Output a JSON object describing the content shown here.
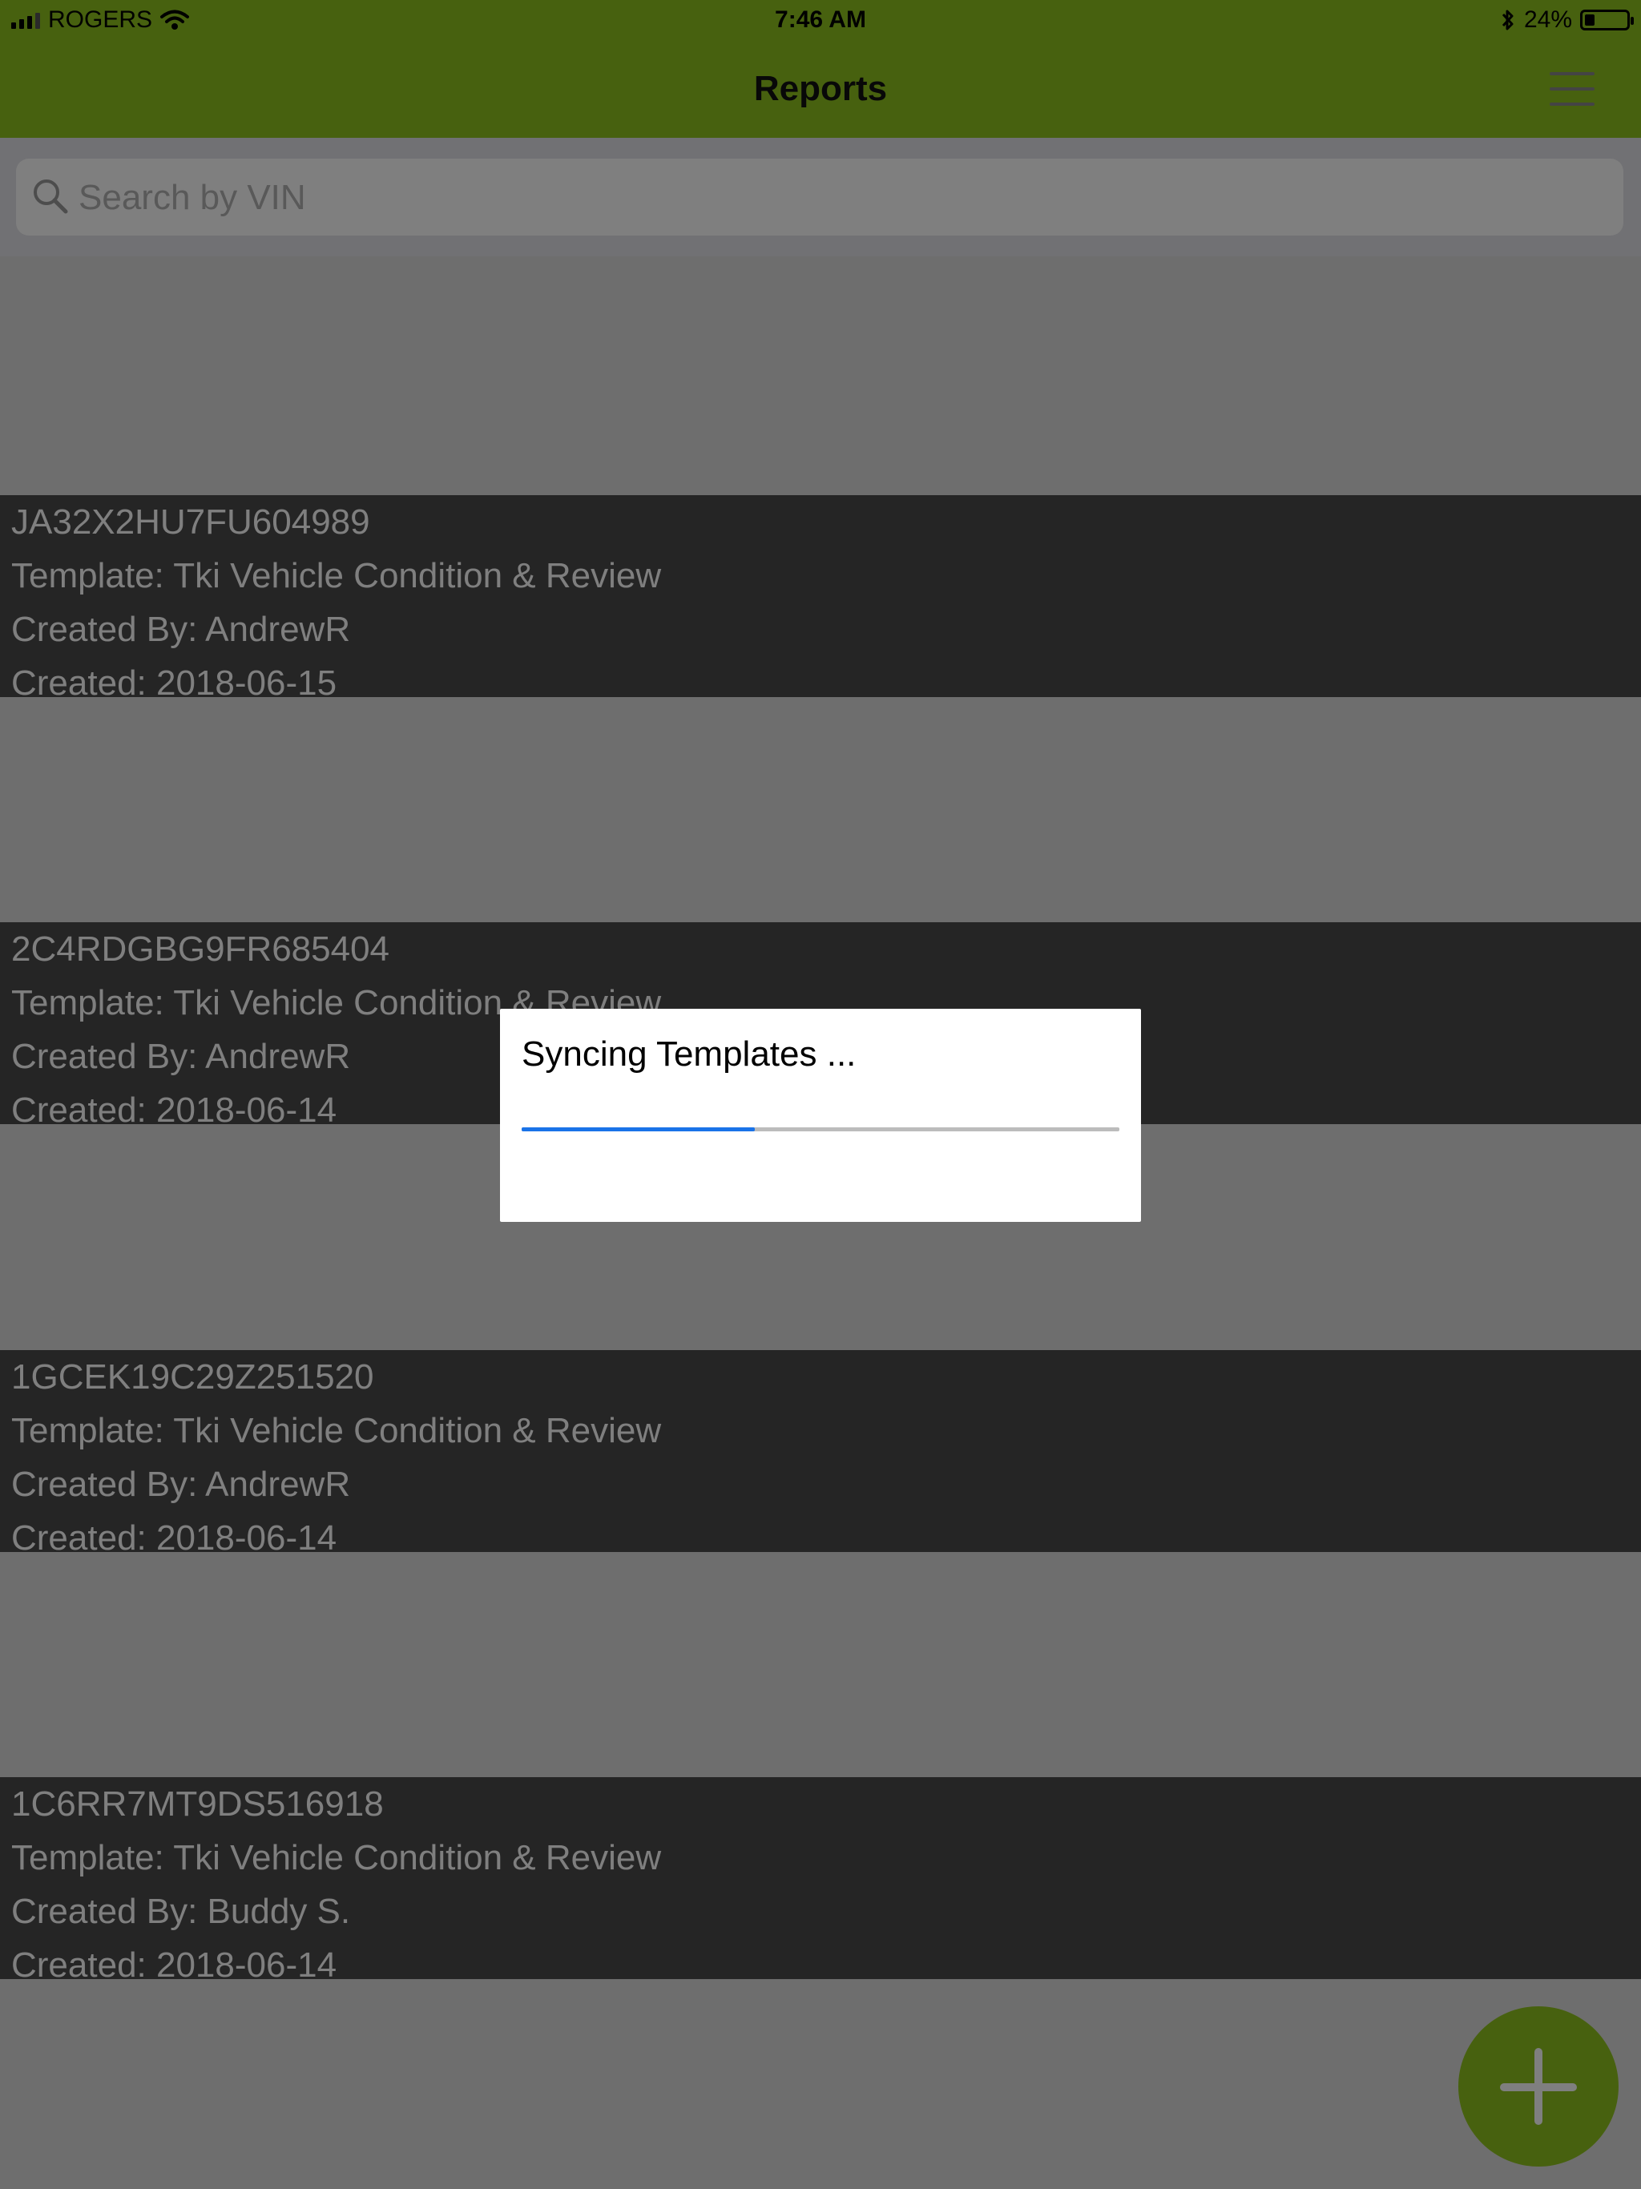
{
  "status_bar": {
    "carrier": "ROGERS",
    "time": "7:46 AM",
    "battery_percent": "24%",
    "icons": [
      "signal-icon",
      "wifi-icon",
      "bluetooth-icon",
      "battery-icon"
    ]
  },
  "navbar": {
    "title": "Reports",
    "menu_icon": "hamburger-menu-icon"
  },
  "search": {
    "placeholder": "Search by VIN",
    "icon": "search-icon"
  },
  "reports": [
    {
      "vin": "JA32X2HU7FU604989",
      "template": "Template: Tki Vehicle Condition & Review",
      "created_by": "Created By: AndrewR",
      "created": "Created: 2018-06-15"
    },
    {
      "vin": "2C4RDGBG9FR685404",
      "template": "Template: Tki Vehicle Condition & Review",
      "created_by": "Created By: AndrewR",
      "created": "Created: 2018-06-14"
    },
    {
      "vin": "1GCEK19C29Z251520",
      "template": "Template: Tki Vehicle Condition & Review",
      "created_by": "Created By: AndrewR",
      "created": "Created: 2018-06-14"
    },
    {
      "vin": "1C6RR7MT9DS516918",
      "template": "Template: Tki Vehicle Condition & Review",
      "created_by": "Created By: Buddy  S.",
      "created": "Created: 2018-06-14"
    }
  ],
  "dialog": {
    "message": "Syncing Templates ...",
    "progress": 0.39
  },
  "fab": {
    "icon": "plus-icon"
  },
  "colors": {
    "brand_green": "#8fc31f",
    "progress_blue": "#1a73e8"
  }
}
